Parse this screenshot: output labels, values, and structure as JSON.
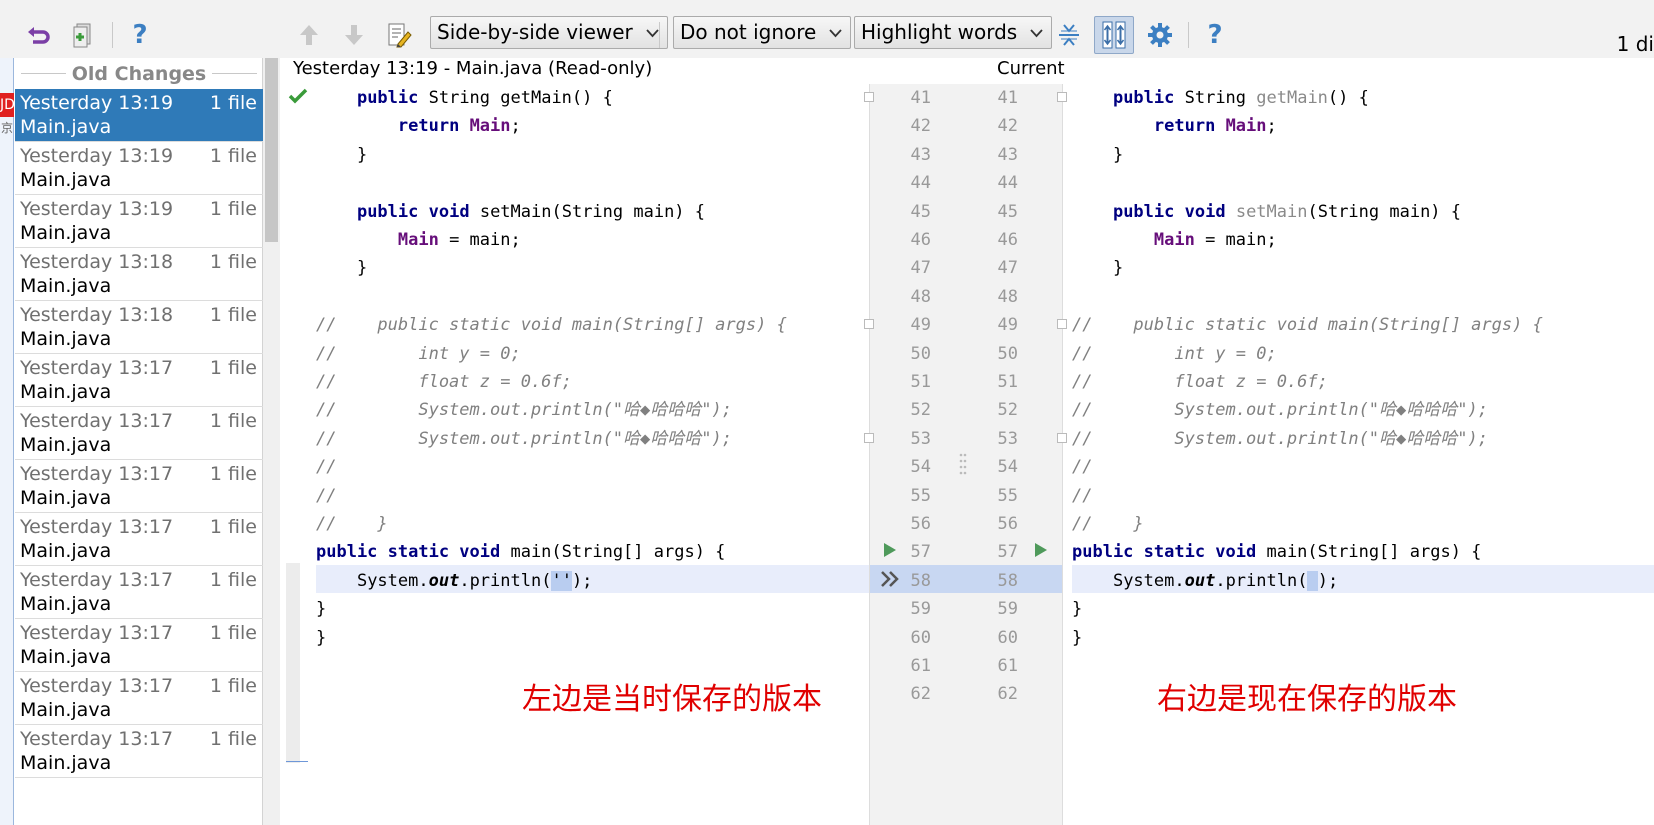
{
  "toolbar": {
    "undo_icon": "undo-icon",
    "diff_view_combo": "Side-by-side viewer",
    "ignore_combo": "Do not ignore",
    "highlight_combo": "Highlight words",
    "help": "?",
    "help2": "?",
    "diff_count": "1 di"
  },
  "left_strip": {
    "badge": "JD",
    "sub": "京"
  },
  "changes": {
    "title": "Old Changes",
    "items": [
      {
        "date": "Yesterday 13:19",
        "count": "1 file",
        "file": "Main.java",
        "selected": true
      },
      {
        "date": "Yesterday 13:19",
        "count": "1 file",
        "file": "Main.java"
      },
      {
        "date": "Yesterday 13:19",
        "count": "1 file",
        "file": "Main.java"
      },
      {
        "date": "Yesterday 13:18",
        "count": "1 file",
        "file": "Main.java"
      },
      {
        "date": "Yesterday 13:18",
        "count": "1 file",
        "file": "Main.java"
      },
      {
        "date": "Yesterday 13:17",
        "count": "1 file",
        "file": "Main.java"
      },
      {
        "date": "Yesterday 13:17",
        "count": "1 file",
        "file": "Main.java"
      },
      {
        "date": "Yesterday 13:17",
        "count": "1 file",
        "file": "Main.java"
      },
      {
        "date": "Yesterday 13:17",
        "count": "1 file",
        "file": "Main.java"
      },
      {
        "date": "Yesterday 13:17",
        "count": "1 file",
        "file": "Main.java"
      },
      {
        "date": "Yesterday 13:17",
        "count": "1 file",
        "file": "Main.java"
      },
      {
        "date": "Yesterday 13:17",
        "count": "1 file",
        "file": "Main.java"
      },
      {
        "date": "Yesterday 13:17",
        "count": "1 file",
        "file": "Main.java"
      }
    ]
  },
  "left_header": "Yesterday 13:19 - Main.java (Read-only)",
  "right_header": "Current",
  "line_numbers": [
    "41",
    "42",
    "43",
    "44",
    "45",
    "46",
    "47",
    "48",
    "49",
    "50",
    "51",
    "52",
    "53",
    "54",
    "55",
    "56",
    "57",
    "58",
    "59",
    "60",
    "61",
    "62"
  ],
  "code": {
    "l41_kw": "public",
    "l41_rest": " String ",
    "l41_m": "getMain",
    "l41_end": "() {",
    "l42_kw": "return",
    "l42_fld": "Main",
    "l42_end": ";",
    "l43": "}",
    "l45_kw": "public",
    "l45_kw2": "void",
    "l45_m": "setMain",
    "l45_end": "(String main) {",
    "l46_fld": "Main",
    "l46_end": " = main;",
    "l47": "}",
    "l49": "//    public static void main(String[] args) {",
    "l50": "//        int y = 0;",
    "l51": "//        float z = 0.6f;",
    "l52": "//        System.out.println(\"哈◆哈哈哈\");",
    "l53": "//        System.out.println(\"哈◆哈哈哈\");",
    "l54": "//",
    "l55": "//",
    "l56": "//    }",
    "l57_kw": "public static void",
    "l57_end": " main(String[] args) {",
    "l58_a": "System.",
    "l58_out": "out",
    "l58_b": ".println(",
    "l58_left_str": "''",
    "l58_right_str": " ",
    "l58_end": ");",
    "l59": "}",
    "l60": "}"
  },
  "captions": {
    "left": "左边是当时保存的版本",
    "right": "右边是现在保存的版本"
  }
}
